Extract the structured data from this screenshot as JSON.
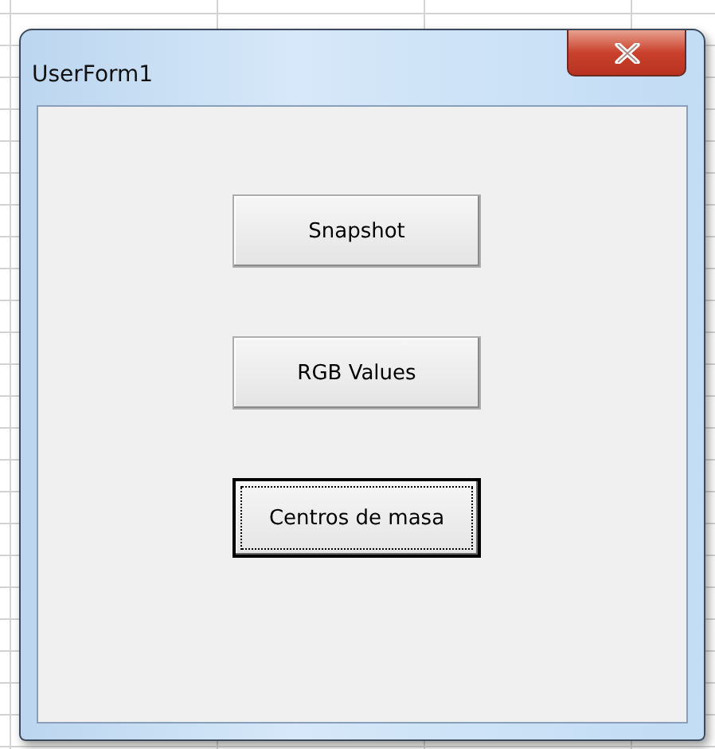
{
  "window": {
    "title": "UserForm1"
  },
  "buttons": [
    {
      "label": "Snapshot",
      "focused": false
    },
    {
      "label": "RGB Values",
      "focused": false
    },
    {
      "label": "Centros de masa",
      "focused": true
    }
  ]
}
